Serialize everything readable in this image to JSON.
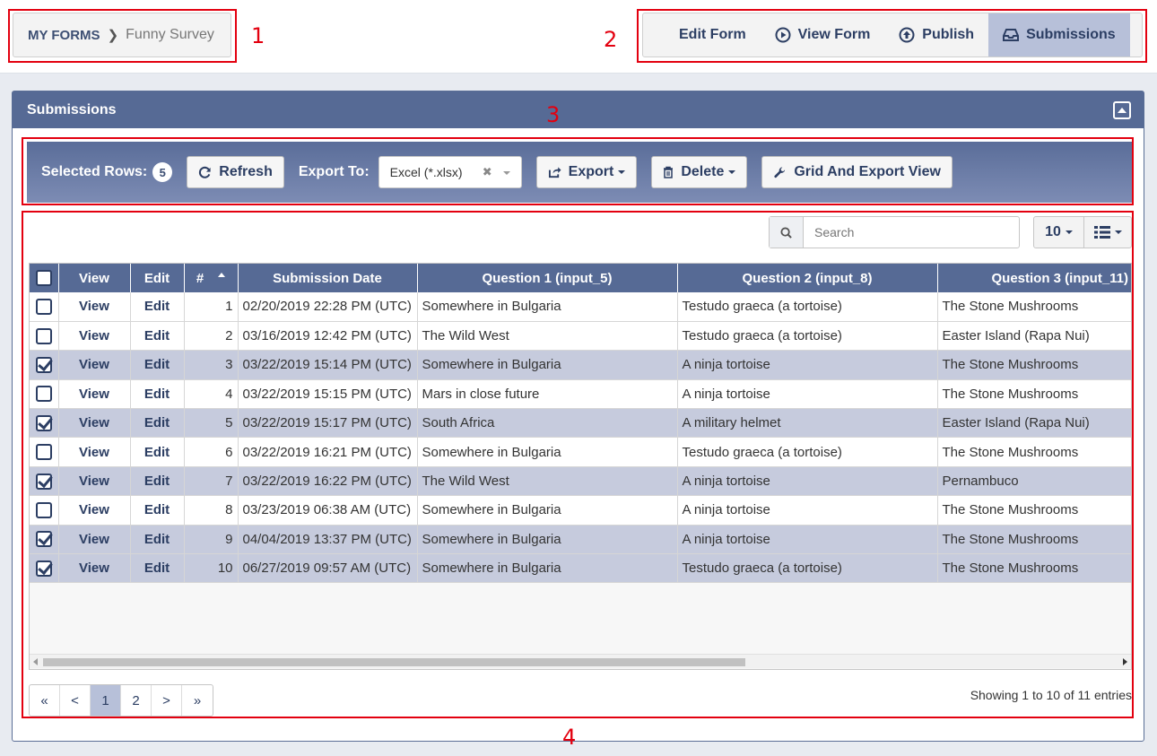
{
  "breadcrumb": {
    "home": "MY FORMS",
    "current": "Funny Survey"
  },
  "nav": {
    "edit": "Edit Form",
    "view": "View Form",
    "publish": "Publish",
    "submissions": "Submissions"
  },
  "callouts": [
    "1",
    "2",
    "3",
    "4"
  ],
  "panel": {
    "title": "Submissions"
  },
  "toolbar": {
    "selected_label": "Selected Rows:",
    "selected_count": "5",
    "refresh": "Refresh",
    "export_to_label": "Export To:",
    "export_format": "Excel (*.xlsx)",
    "export": "Export",
    "delete": "Delete",
    "grid_view": "Grid And Export View"
  },
  "search": {
    "placeholder": "Search"
  },
  "page_size": "10",
  "table": {
    "headers": [
      "View",
      "Edit",
      "#",
      "Submission Date",
      "Question 1 (input_5)",
      "Question 2 (input_8)",
      "Question 3 (input_11)"
    ],
    "rows": [
      {
        "selected": false,
        "view": "View",
        "edit": "Edit",
        "num": "1",
        "date": "02/20/2019 22:28 PM (UTC)",
        "q1": "Somewhere in Bulgaria",
        "q2": "Testudo graeca (a tortoise)",
        "q3": "The Stone Mushrooms"
      },
      {
        "selected": false,
        "view": "View",
        "edit": "Edit",
        "num": "2",
        "date": "03/16/2019 12:42 PM (UTC)",
        "q1": "The Wild West",
        "q2": "Testudo graeca (a tortoise)",
        "q3": "Easter Island (Rapa Nui)"
      },
      {
        "selected": true,
        "view": "View",
        "edit": "Edit",
        "num": "3",
        "date": "03/22/2019 15:14 PM (UTC)",
        "q1": "Somewhere in Bulgaria",
        "q2": "A ninja tortoise",
        "q3": "The Stone Mushrooms"
      },
      {
        "selected": false,
        "view": "View",
        "edit": "Edit",
        "num": "4",
        "date": "03/22/2019 15:15 PM (UTC)",
        "q1": "Mars in close future",
        "q2": "A ninja tortoise",
        "q3": "The Stone Mushrooms"
      },
      {
        "selected": true,
        "view": "View",
        "edit": "Edit",
        "num": "5",
        "date": "03/22/2019 15:17 PM (UTC)",
        "q1": "South Africa",
        "q2": "A military helmet",
        "q3": "Easter Island (Rapa Nui)"
      },
      {
        "selected": false,
        "view": "View",
        "edit": "Edit",
        "num": "6",
        "date": "03/22/2019 16:21 PM (UTC)",
        "q1": "Somewhere in Bulgaria",
        "q2": "Testudo graeca (a tortoise)",
        "q3": "The Stone Mushrooms"
      },
      {
        "selected": true,
        "view": "View",
        "edit": "Edit",
        "num": "7",
        "date": "03/22/2019 16:22 PM (UTC)",
        "q1": "The Wild West",
        "q2": "A ninja tortoise",
        "q3": "Pernambuco"
      },
      {
        "selected": false,
        "view": "View",
        "edit": "Edit",
        "num": "8",
        "date": "03/23/2019 06:38 AM (UTC)",
        "q1": "Somewhere in Bulgaria",
        "q2": "A ninja tortoise",
        "q3": "The Stone Mushrooms"
      },
      {
        "selected": true,
        "view": "View",
        "edit": "Edit",
        "num": "9",
        "date": "04/04/2019 13:37 PM (UTC)",
        "q1": "Somewhere in Bulgaria",
        "q2": "A ninja tortoise",
        "q3": "The Stone Mushrooms"
      },
      {
        "selected": true,
        "view": "View",
        "edit": "Edit",
        "num": "10",
        "date": "06/27/2019 09:57 AM (UTC)",
        "q1": "Somewhere in Bulgaria",
        "q2": "Testudo graeca (a tortoise)",
        "q3": "The Stone Mushrooms"
      }
    ]
  },
  "pagination": {
    "first": "«",
    "prev": "<",
    "pages": [
      "1",
      "2"
    ],
    "next": ">",
    "last": "»",
    "active": "1"
  },
  "footer": {
    "showing": "Showing 1 to 10 of 11 entries"
  },
  "colors": {
    "header": "#566a95",
    "selected_row": "#c6cbdd",
    "active_nav": "#b7c0d9",
    "callout": "#e3000f"
  }
}
